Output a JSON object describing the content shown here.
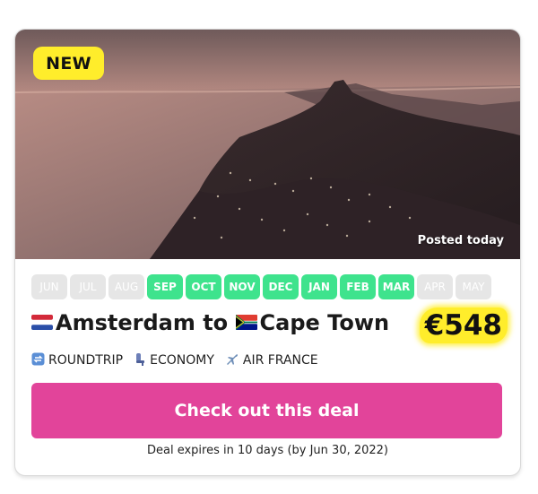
{
  "badge": {
    "label": "NEW",
    "color": "#ffed2b"
  },
  "hero": {
    "posted_label": "Posted today",
    "image": "cape-town-coastline-sunset-photo"
  },
  "months": [
    {
      "label": "JUN",
      "active": false
    },
    {
      "label": "JUL",
      "active": false
    },
    {
      "label": "AUG",
      "active": false
    },
    {
      "label": "SEP",
      "active": true
    },
    {
      "label": "OCT",
      "active": true
    },
    {
      "label": "NOV",
      "active": true
    },
    {
      "label": "DEC",
      "active": true
    },
    {
      "label": "JAN",
      "active": true
    },
    {
      "label": "FEB",
      "active": true
    },
    {
      "label": "MAR",
      "active": true
    },
    {
      "label": "APR",
      "active": false
    },
    {
      "label": "MAY",
      "active": false
    }
  ],
  "route": {
    "origin": "Amsterdam",
    "connector": "to",
    "destination": "Cape Town",
    "origin_flag": "netherlands-flag-icon",
    "destination_flag": "south-africa-flag-icon"
  },
  "price": {
    "value": "€548",
    "highlight_color": "#ffed2b"
  },
  "details": {
    "trip_type": "ROUNDTRIP",
    "cabin": "ECONOMY",
    "airline": "AIR FRANCE"
  },
  "cta": {
    "label": "Check out this deal",
    "color": "#e2449a"
  },
  "expiry": {
    "text": "Deal expires in 10 days (by Jun 30, 2022)"
  },
  "colors": {
    "month_active": "#3ee38d",
    "month_inactive": "#e6e6e6"
  }
}
